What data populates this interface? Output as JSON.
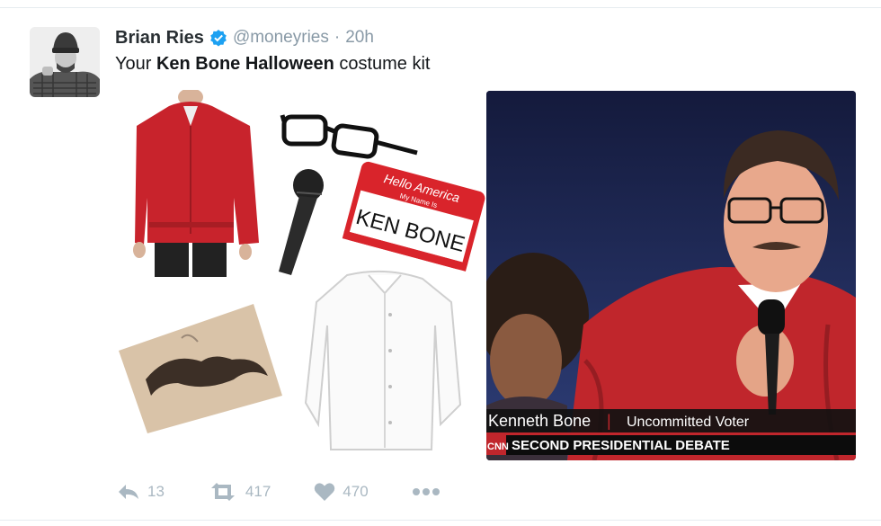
{
  "tweet": {
    "author_name": "Brian Ries",
    "handle": "@moneyries",
    "separator": "·",
    "time": "20h",
    "text_parts": [
      "Your ",
      "Ken Bone Halloween",
      " costume kit"
    ]
  },
  "kit": {
    "name_tag": {
      "line1": "Hello America",
      "line2": "My Name Is",
      "name": "KEN BONE"
    }
  },
  "photo": {
    "lower_third_name": "Kenneth Bone",
    "lower_third_divider": "|",
    "lower_third_role": "Uncommitted Voter",
    "network": "CNN",
    "banner": "SECOND PRESIDENTIAL DEBATE"
  },
  "actions": {
    "reply_count": "13",
    "retweet_count": "417",
    "like_count": "470"
  },
  "icons": {
    "verified": "verified-badge-icon",
    "reply": "reply-icon",
    "retweet": "retweet-icon",
    "like": "heart-icon",
    "more": "more-dots-icon"
  },
  "colors": {
    "verified_blue": "#1da1f2",
    "action_gray": "#aab8c2",
    "name_tag_red": "#d9242b",
    "sweater_red": "#c8232c"
  }
}
